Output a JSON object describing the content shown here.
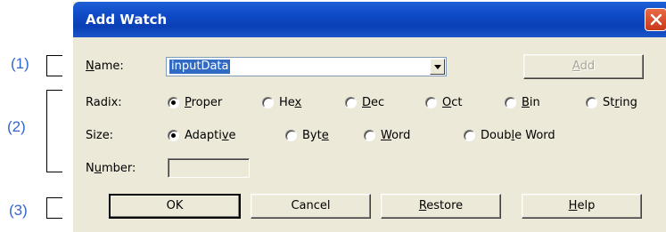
{
  "callouts": {
    "c1": "(1)",
    "c2": "(2)",
    "c3": "(3)"
  },
  "dialog": {
    "title": "Add Watch"
  },
  "name": {
    "label_pre": "",
    "label_u": "N",
    "label_post": "ame:",
    "value": "inputData",
    "add_pre": "",
    "add_u": "A",
    "add_post": "dd"
  },
  "radix": {
    "label": "Radix:",
    "options": [
      {
        "pre": "",
        "u": "P",
        "post": "roper",
        "selected": true
      },
      {
        "pre": "He",
        "u": "x",
        "post": "",
        "selected": false
      },
      {
        "pre": "",
        "u": "D",
        "post": "ec",
        "selected": false
      },
      {
        "pre": "",
        "u": "O",
        "post": "ct",
        "selected": false
      },
      {
        "pre": "",
        "u": "B",
        "post": "in",
        "selected": false
      },
      {
        "pre": "St",
        "u": "r",
        "post": "ing",
        "selected": false
      }
    ]
  },
  "size": {
    "label": "Size:",
    "options": [
      {
        "pre": "Adapti",
        "u": "v",
        "post": "e",
        "selected": true
      },
      {
        "pre": "Byt",
        "u": "e",
        "post": "",
        "selected": false
      },
      {
        "pre": "",
        "u": "W",
        "post": "ord",
        "selected": false
      },
      {
        "pre": "Doub",
        "u": "l",
        "post": "e Word",
        "selected": false
      }
    ]
  },
  "number": {
    "label_pre": "N",
    "label_u": "u",
    "label_post": "mber:",
    "value": ""
  },
  "buttons": {
    "ok": "OK",
    "cancel": "Cancel",
    "restore_pre": "",
    "restore_u": "R",
    "restore_post": "estore",
    "help_pre": "",
    "help_u": "H",
    "help_post": "elp"
  }
}
